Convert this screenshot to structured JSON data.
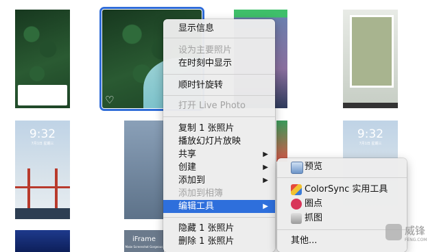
{
  "context_menu": {
    "items": [
      {
        "label": "显示信息",
        "disabled": false
      },
      {
        "label": "设为主要照片",
        "disabled": true
      },
      {
        "label": "在时刻中显示",
        "disabled": false
      },
      {
        "label": "顺时针旋转",
        "disabled": false
      },
      {
        "label": "打开 Live Photo",
        "disabled": true
      },
      {
        "label": "复制 1 张照片",
        "disabled": false
      },
      {
        "label": "播放幻灯片放映",
        "disabled": false
      },
      {
        "label": "共享",
        "disabled": false,
        "submenu": true
      },
      {
        "label": "创建",
        "disabled": false,
        "submenu": true
      },
      {
        "label": "添加到",
        "disabled": false,
        "submenu": true
      },
      {
        "label": "添加到相簿",
        "disabled": true
      },
      {
        "label": "编辑工具",
        "disabled": false,
        "submenu": true,
        "highlighted": true
      },
      {
        "label": "隐藏 1 张照片",
        "disabled": false
      },
      {
        "label": "删除 1 张照片",
        "disabled": false
      }
    ]
  },
  "submenu": {
    "items": [
      {
        "label": "预览",
        "icon": "preview-icon"
      },
      {
        "label": "ColorSync 实用工具",
        "icon": "colorsync-icon"
      },
      {
        "label": "圈点",
        "icon": "skitch-icon"
      },
      {
        "label": "抓图",
        "icon": "grab-icon"
      },
      {
        "label": "其他...",
        "icon": ""
      }
    ]
  },
  "thumbnails": {
    "lock_time": "9:32",
    "lock_date": "7月1日 星期三",
    "iframe_title": "iFrame",
    "iframe_subtitle": "Make Screenshot Gorgeous"
  },
  "watermark": {
    "name": "威锋",
    "domain": "FENG.COM"
  },
  "colors": {
    "highlight": "#2e6fdc",
    "selection": "#2f6cd8"
  }
}
